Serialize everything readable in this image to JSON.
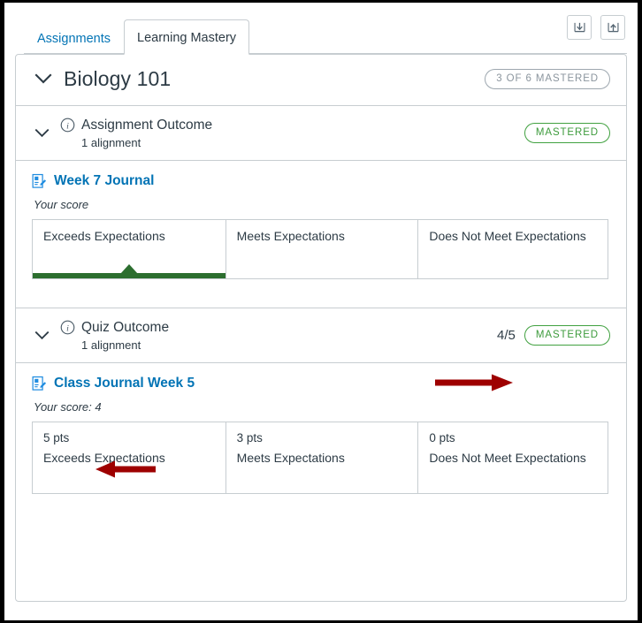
{
  "tabs": [
    {
      "label": "Assignments",
      "active": false,
      "name": "tab-assignments"
    },
    {
      "label": "Learning Mastery",
      "active": true,
      "name": "tab-learning-mastery"
    }
  ],
  "toolbar": {
    "import_label": "download-icon",
    "export_label": "upload-icon"
  },
  "course": {
    "title": "Biology 101",
    "mastery_badge": "3 OF 6 MASTERED"
  },
  "outcomes": [
    {
      "name": "Assignment Outcome",
      "alignments_text": "1 alignment",
      "score": "",
      "badge": "MASTERED",
      "alignment": {
        "title": "Week 7 Journal",
        "your_score_label": "Your score",
        "ratings": [
          {
            "pts": "",
            "label": "Exceeds Expectations",
            "selected": true
          },
          {
            "pts": "",
            "label": "Meets Expectations",
            "selected": false
          },
          {
            "pts": "",
            "label": "Does Not Meet Expectations",
            "selected": false
          }
        ]
      }
    },
    {
      "name": "Quiz Outcome",
      "alignments_text": "1 alignment",
      "score": "4/5",
      "badge": "MASTERED",
      "alignment": {
        "title": "Class Journal Week 5",
        "your_score_label": "Your score: 4",
        "ratings": [
          {
            "pts": "5 pts",
            "label": "Exceeds Expectations",
            "selected": false
          },
          {
            "pts": "3 pts",
            "label": "Meets Expectations",
            "selected": false
          },
          {
            "pts": "0 pts",
            "label": "Does Not Meet Expectations",
            "selected": false
          }
        ]
      }
    }
  ],
  "annotations": {
    "arrow_color": "#9E0000",
    "arrow_score_note": "points-right-at-score",
    "arrow_your_score_note": "points-left-at-your-score"
  },
  "colors": {
    "link": "#0374B5",
    "text": "#2D3B45",
    "border": "#C7CDD1",
    "mastered_green": "#3D9B3C",
    "bar_green": "#2C6E2F",
    "annotation_red": "#9E0000"
  }
}
